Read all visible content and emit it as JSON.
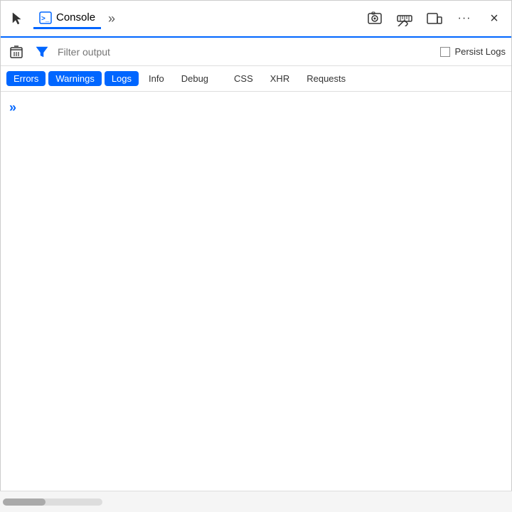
{
  "toolbar": {
    "console_label": "Console",
    "more_label": "»",
    "close_label": "×",
    "more_options_label": "···"
  },
  "filter_row": {
    "placeholder": "Filter output",
    "persist_logs_label": "Persist Logs"
  },
  "filter_tabs": {
    "tabs": [
      {
        "id": "errors",
        "label": "Errors",
        "state": "active-errors"
      },
      {
        "id": "warnings",
        "label": "Warnings",
        "state": "active-warnings"
      },
      {
        "id": "logs",
        "label": "Logs",
        "state": "active-logs"
      },
      {
        "id": "info",
        "label": "Info",
        "state": "inactive"
      },
      {
        "id": "debug",
        "label": "Debug",
        "state": "inactive"
      },
      {
        "id": "css",
        "label": "CSS",
        "state": "inactive"
      },
      {
        "id": "xhr",
        "label": "XHR",
        "state": "inactive"
      },
      {
        "id": "requests",
        "label": "Requests",
        "state": "inactive"
      }
    ]
  },
  "console_output": {
    "prompt_symbol": "»"
  }
}
